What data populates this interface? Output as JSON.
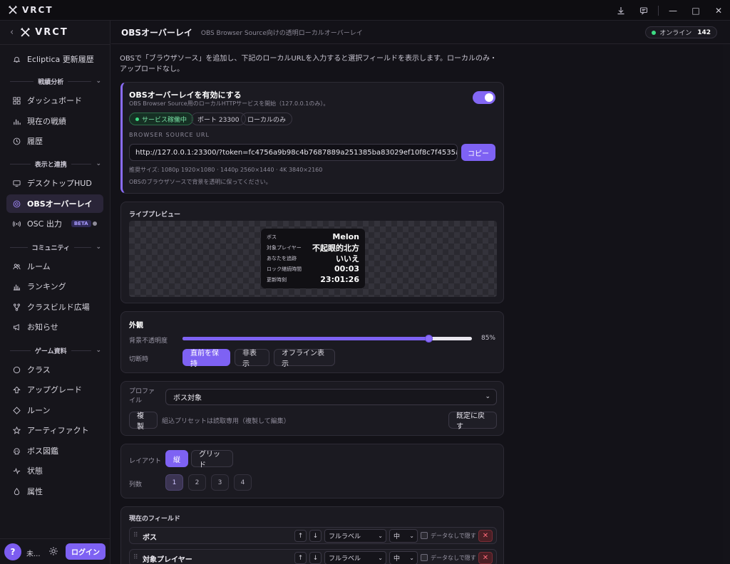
{
  "window": {
    "app_name": "VRCT",
    "icons": [
      "download-icon",
      "chat-icon"
    ],
    "controls": [
      "minimize",
      "maximize",
      "close"
    ]
  },
  "sidebar": {
    "brand": "VRCT",
    "top_item": "Ecliptica 更新履歴",
    "groups": {
      "analysis": "戦績分析",
      "display": "表示と連携",
      "community": "コミュニティ",
      "game": "ゲーム資料"
    },
    "items": {
      "dashboard": "ダッシュボード",
      "current": "現在の戦績",
      "history": "履歴",
      "hud": "デスクトップHUD",
      "obs": "OBSオーバーレイ",
      "osc": "OSC 出力",
      "osc_badge": "BETA",
      "rooms": "ルーム",
      "ranking": "ランキング",
      "builds": "クラスビルド広場",
      "news": "お知らせ",
      "class": "クラス",
      "upgrade": "アップグレード",
      "rune": "ルーン",
      "artifact": "アーティファクト",
      "boss": "ボス図鑑",
      "status": "状態",
      "attribute": "属性"
    },
    "footer": {
      "avatar": "?",
      "user": "未...",
      "login": "ログイン"
    }
  },
  "header": {
    "title": "OBSオーバーレイ",
    "subtitle": "OBS Browser Source向けの透明ローカルオーバーレイ",
    "online_label": "オンライン",
    "online_count": "142"
  },
  "intro": "OBSで「ブラウザソース」を追加し、下記のローカルURLを入力すると選択フィールドを表示します。ローカルのみ・アップロードなし。",
  "enable_card": {
    "title": "OBSオーバーレイを有効にする",
    "desc": "OBS Browser Source用のローカルHTTPサービスを開始（127.0.0.1のみ）。",
    "enabled": true,
    "chip_running": "サービス稼働中",
    "chip_port": "ポート 23300",
    "chip_local": "ローカルのみ",
    "url_label": "BROWSER SOURCE URL",
    "url": "http://127.0.0.1:23300/?token=fc4756a9b98c4b7687889a251385ba83029ef10f8c7f4535a5300c33edb56153",
    "copy": "コピー",
    "resolution_note": "推奨サイズ: 1080p 1920×1080 · 1440p 2560×1440 · 4K 3840×2160",
    "transparent_note": "OBSのブラウザソースで背景を透明に保ってください。"
  },
  "preview": {
    "title": "ライブプレビュー",
    "rows": [
      {
        "key": "ボス",
        "value": "Melon"
      },
      {
        "key": "対象プレイヤー",
        "value": "不起眼的北方"
      },
      {
        "key": "あなたを追跡",
        "value": "いいえ"
      },
      {
        "key": "ロック継続時間",
        "value": "00:03"
      },
      {
        "key": "更新時刻",
        "value": "23:01:26"
      }
    ]
  },
  "appearance": {
    "title": "外観",
    "opacity_label": "背景不透明度",
    "opacity_value": "85%",
    "opacity": 0.85,
    "disconnect_label": "切断時",
    "options": [
      "直前を保持",
      "非表示",
      "オフライン表示"
    ],
    "selected": 0
  },
  "profile": {
    "label": "プロファイル",
    "selected": "ボス対象",
    "duplicate": "複製",
    "note": "組込プリセットは読取専用（複製して編集）",
    "reset": "既定に戻す"
  },
  "layout": {
    "label": "レイアウト",
    "options": [
      "縦",
      "グリッド"
    ],
    "selected": 0,
    "columns_label": "列数",
    "columns": [
      "1",
      "2",
      "3",
      "4"
    ],
    "columns_selected": 0
  },
  "fields": {
    "title": "現在のフィールド",
    "rows": [
      {
        "name": "ボス",
        "label_mode": "フルラベル",
        "size": "中",
        "hide_label": "データなしで隠す"
      },
      {
        "name": "対象プレイヤー",
        "label_mode": "フルラベル",
        "size": "中",
        "hide_label": "データなしで隠す"
      }
    ],
    "up": "↑",
    "down": "↓",
    "delete": "✕",
    "grip": "⠿"
  },
  "colors": {
    "accent": "#7e62f3",
    "online": "#3ddc84",
    "danger": "#ff6b7a"
  }
}
